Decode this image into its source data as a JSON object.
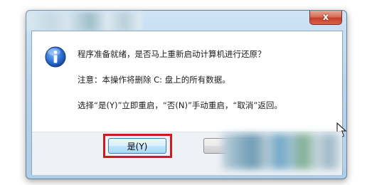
{
  "dialog": {
    "close_label": "x",
    "message_line1": "程序准备就绪，是否马上重新启动计算机进行还原？",
    "message_line2": "注意：本操作将删除 C: 盘上的所有数据。",
    "message_line3": "选择“是(Y)”立即重启，“否(N)”手动重启，“取消”返回。",
    "yes_label": "是(Y)"
  },
  "icons": {
    "info": "info-icon",
    "cursor": "mouse-cursor-icon"
  },
  "colors": {
    "highlight_border": "#d11a1a",
    "info_blue": "#1f5fbf"
  }
}
